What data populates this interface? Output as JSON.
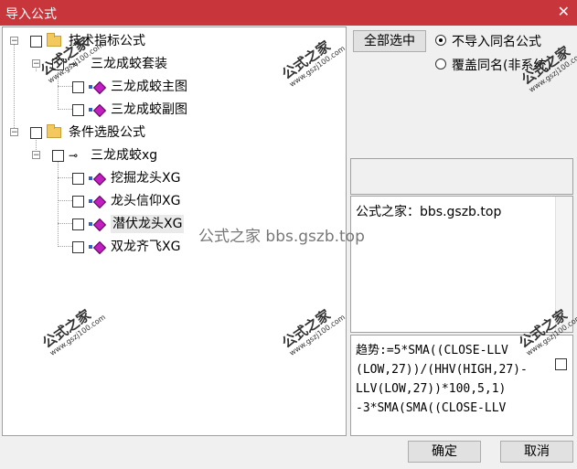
{
  "window": {
    "title": "导入公式",
    "close_glyph": "✕"
  },
  "tree": {
    "nodes": [
      {
        "label": "技术指标公式",
        "type": "folder"
      },
      {
        "label": "三龙成蛟套装",
        "type": "key"
      },
      {
        "label": "三龙成蛟主图",
        "type": "formula"
      },
      {
        "label": "三龙成蛟副图",
        "type": "formula"
      },
      {
        "label": "条件选股公式",
        "type": "folder"
      },
      {
        "label": "三龙成蛟xg",
        "type": "key"
      },
      {
        "label": "挖掘龙头XG",
        "type": "formula"
      },
      {
        "label": "龙头信仰XG",
        "type": "formula"
      },
      {
        "label": "潜伏龙头XG",
        "type": "formula"
      },
      {
        "label": "双龙齐飞XG",
        "type": "formula"
      }
    ]
  },
  "buttons": {
    "select_all": "全部选中",
    "ok": "确定",
    "cancel": "取消"
  },
  "options": {
    "skip_same_name": "不导入同名公式",
    "overwrite_same_name": "覆盖同名(非系统)",
    "selected": "skip_same_name"
  },
  "description": "公式之家：bbs.gszb.top",
  "code_preview": [
    "趋势:=5*SMA((CLOSE-LLV",
    "(LOW,27))/(HHV(HIGH,27)-",
    "LLV(LOW,27))*100,5,1)",
    "-3*SMA(SMA((CLOSE-LLV"
  ],
  "watermark": {
    "main": "公式之家",
    "url": "www.gszj100.com",
    "center": "公式之家 bbs.gszb.top"
  },
  "colors": {
    "titlebar": "#c8363b",
    "folder": "#f3c85c",
    "formula_icon": "#c020c0"
  }
}
